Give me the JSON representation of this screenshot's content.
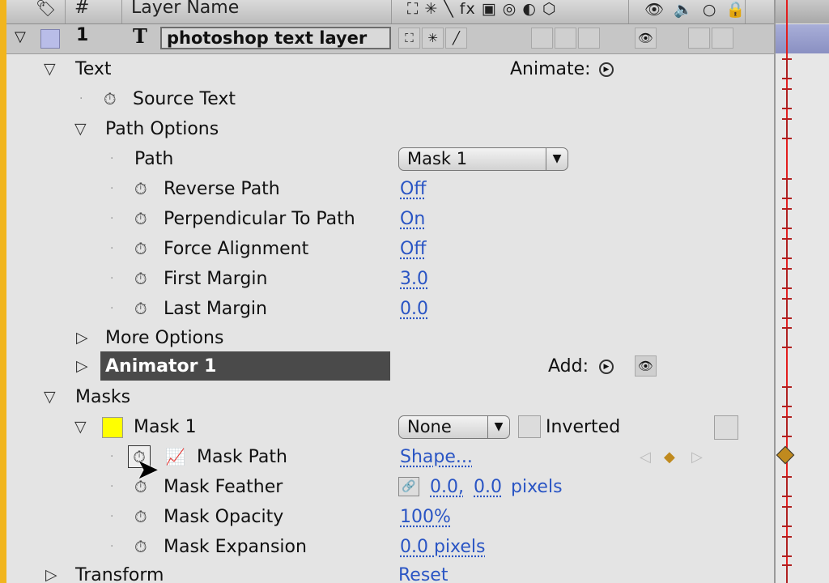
{
  "header": {
    "hash": "#",
    "layer_name": "Layer Name",
    "switch_icons": "⛶ ✳ ╲ fx ▣ ◎ ◐ ⬡",
    "av_icons": "👁 🔈 ○ 🔒"
  },
  "layer": {
    "index": "1",
    "type_glyph": "T",
    "name": "photoshop text layer"
  },
  "text_group": {
    "label": "Text",
    "animate_label": "Animate:"
  },
  "source_text": {
    "label": "Source Text"
  },
  "path_options": {
    "label": "Path Options"
  },
  "path": {
    "label": "Path",
    "value": "Mask 1"
  },
  "reverse_path": {
    "label": "Reverse Path",
    "value": "Off"
  },
  "perpendicular": {
    "label": "Perpendicular To Path",
    "value": "On"
  },
  "force_alignment": {
    "label": "Force Alignment",
    "value": "Off"
  },
  "first_margin": {
    "label": "First Margin",
    "value": "3.0"
  },
  "last_margin": {
    "label": "Last Margin",
    "value": "0.0"
  },
  "more_options": {
    "label": "More Options"
  },
  "animator": {
    "label": "Animator 1",
    "add_label": "Add:"
  },
  "masks": {
    "label": "Masks"
  },
  "mask1": {
    "label": "Mask 1",
    "mode": "None",
    "inverted_label": "Inverted",
    "color": "#ffff00"
  },
  "mask_path": {
    "label": "Mask Path",
    "value": "Shape..."
  },
  "mask_feather": {
    "label": "Mask Feather",
    "value_x": "0.0,",
    "value_y": "0.0",
    "unit": "pixels"
  },
  "mask_opacity": {
    "label": "Mask Opacity",
    "value": "100%"
  },
  "mask_expansion": {
    "label": "Mask Expansion",
    "value": "0.0 pixels"
  },
  "transform": {
    "label": "Transform",
    "value": "Reset"
  }
}
